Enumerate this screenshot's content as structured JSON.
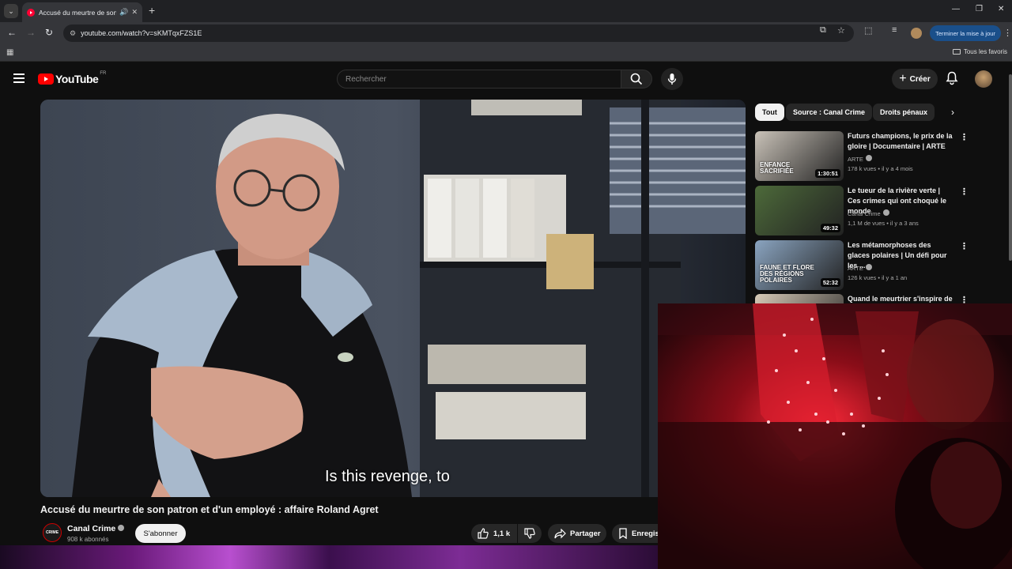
{
  "browser": {
    "tab_title": "Accusé du meurtre de son pat",
    "url": "youtube.com/watch?v=sKMTqxFZS1E",
    "update_button": "Terminer la mise à jour",
    "bookmarks_all": "Tous les favoris"
  },
  "youtube": {
    "logo_text": "YouTube",
    "country_code": "FR",
    "search_placeholder": "Rechercher",
    "create_label": "Créer"
  },
  "video": {
    "subtitle": "Is this revenge, to",
    "title": "Accusé du meurtre de son patron et d'un employé : affaire Roland Agret",
    "channel": "Canal Crime",
    "channel_logo_text": "CRIME",
    "subscribers": "908 k abonnés",
    "subscribe_label": "S'abonner",
    "likes": "1,1 k",
    "share_label": "Partager",
    "save_label": "Enregistrer"
  },
  "chips": [
    "Tout",
    "Source : Canal Crime",
    "Droits pénaux"
  ],
  "recommendations": [
    {
      "title": "Futurs champions, le prix de la gloire | Documentaire | ARTE",
      "channel": "ARTE",
      "meta": "178 k vues • il y a 4 mois",
      "duration": "1:30:51",
      "overlay": "ENFANCE SACRIFIÉE",
      "thumb_color": "#c9c2b8"
    },
    {
      "title": "Le tueur de la rivière verte | Ces crimes qui ont choqué le monde",
      "channel": "Canal Crime",
      "meta": "1,1 M de vues • il y a 3 ans",
      "duration": "49:32",
      "overlay": "",
      "thumb_color": "#4d6a3a"
    },
    {
      "title": "Les métamorphoses des glaces polaires | Un défi pour les ...",
      "channel": "ARTE",
      "meta": "126 k vues • il y a 1 an",
      "duration": "52:32",
      "overlay": "FAUNE ET FLORE DES RÉGIONS POLAIRES",
      "thumb_color": "#8aa4c0"
    },
    {
      "title": "Quand le meurtrier s'inspire de",
      "channel": "",
      "meta": "",
      "duration": "",
      "overlay": "",
      "thumb_color": "#d8cbb8"
    }
  ]
}
